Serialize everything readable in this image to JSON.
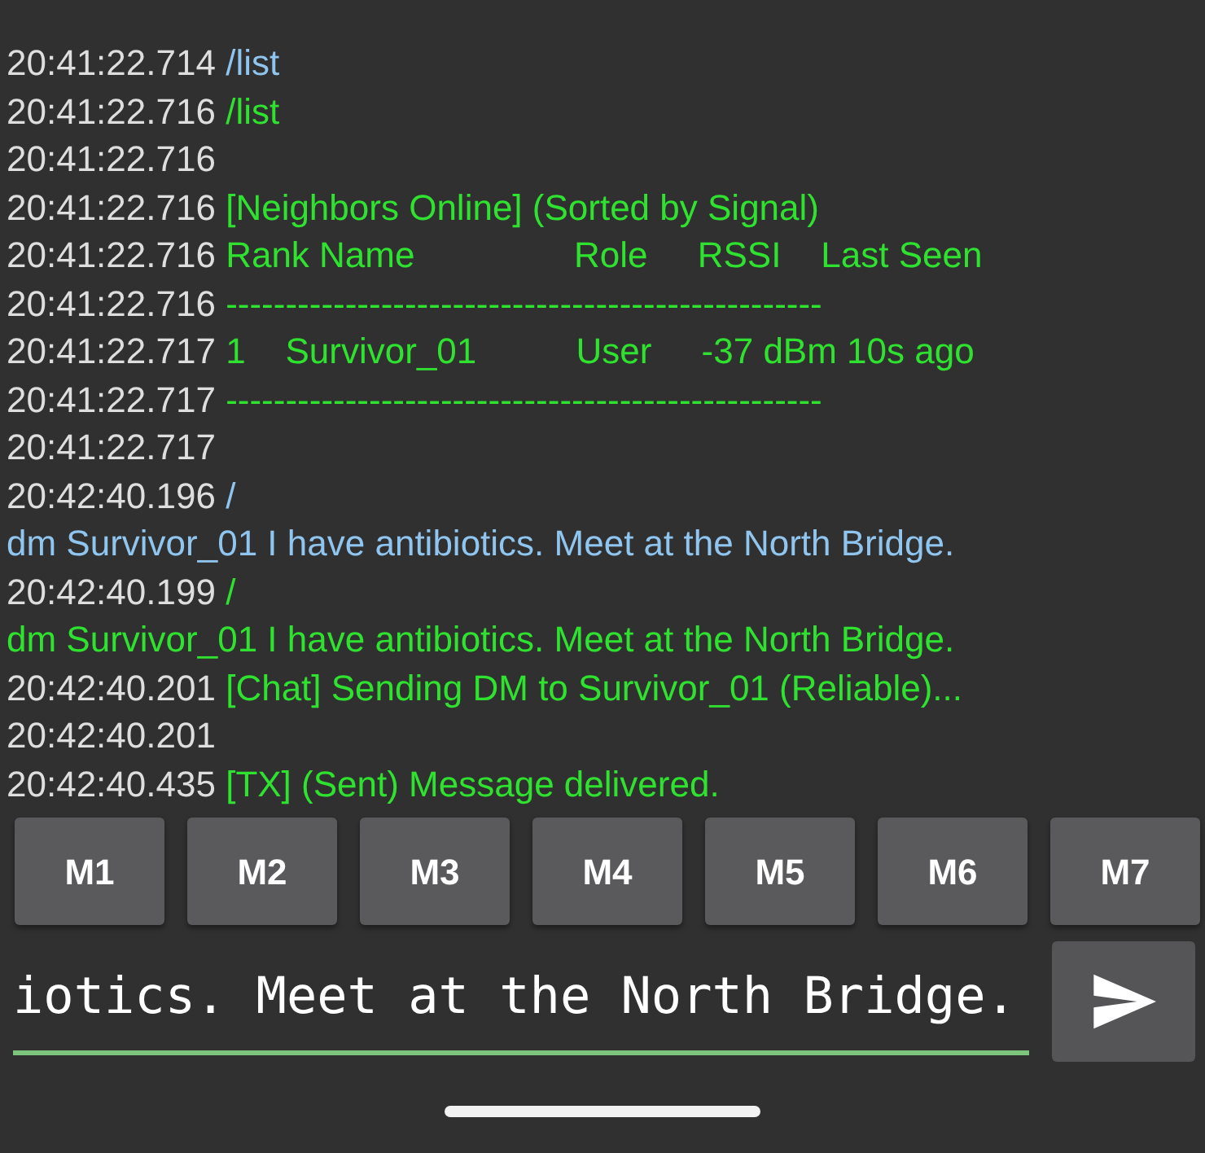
{
  "log": [
    {
      "time": "20:41:22.714",
      "text": "/list",
      "kind": "sent"
    },
    {
      "time": "20:41:22.716",
      "text": "/list",
      "kind": "received"
    },
    {
      "time": "20:41:22.716"
    },
    {
      "time": "20:41:22.716",
      "text": "[Neighbors Online] (Sorted by Signal)",
      "kind": "received"
    },
    {
      "time": "20:41:22.716",
      "text": "Rank Name                Role     RSSI    Last Seen",
      "kind": "received"
    },
    {
      "time": "20:41:22.716",
      "text": "--------------------------------------------------",
      "kind": "received"
    },
    {
      "time": "20:41:22.717",
      "text": "1    Survivor_01          User     -37 dBm 10s ago",
      "kind": "received"
    },
    {
      "time": "20:41:22.717",
      "text": "--------------------------------------------------",
      "kind": "received"
    },
    {
      "time": "20:41:22.717"
    },
    {
      "time": "20:42:40.196",
      "text": "/",
      "kind": "sent"
    },
    {
      "text": "dm Survivor_01 I have antibiotics. Meet at the North Bridge.",
      "kind": "sent"
    },
    {
      "time": "20:42:40.199",
      "text": "/",
      "kind": "received"
    },
    {
      "text": "dm Survivor_01 I have antibiotics. Meet at the North Bridge.",
      "kind": "received"
    },
    {
      "time": "20:42:40.201",
      "text": "[Chat] Sending DM to Survivor_01 (Reliable)...",
      "kind": "received"
    },
    {
      "time": "20:42:40.201"
    },
    {
      "time": "20:42:40.435",
      "text": "[TX] (Sent) Message delivered.",
      "kind": "received"
    }
  ],
  "macro_buttons": [
    "M1",
    "M2",
    "M3",
    "M4",
    "M5",
    "M6",
    "M7"
  ],
  "input": {
    "value": "iotics. Meet at the North Bridge."
  }
}
